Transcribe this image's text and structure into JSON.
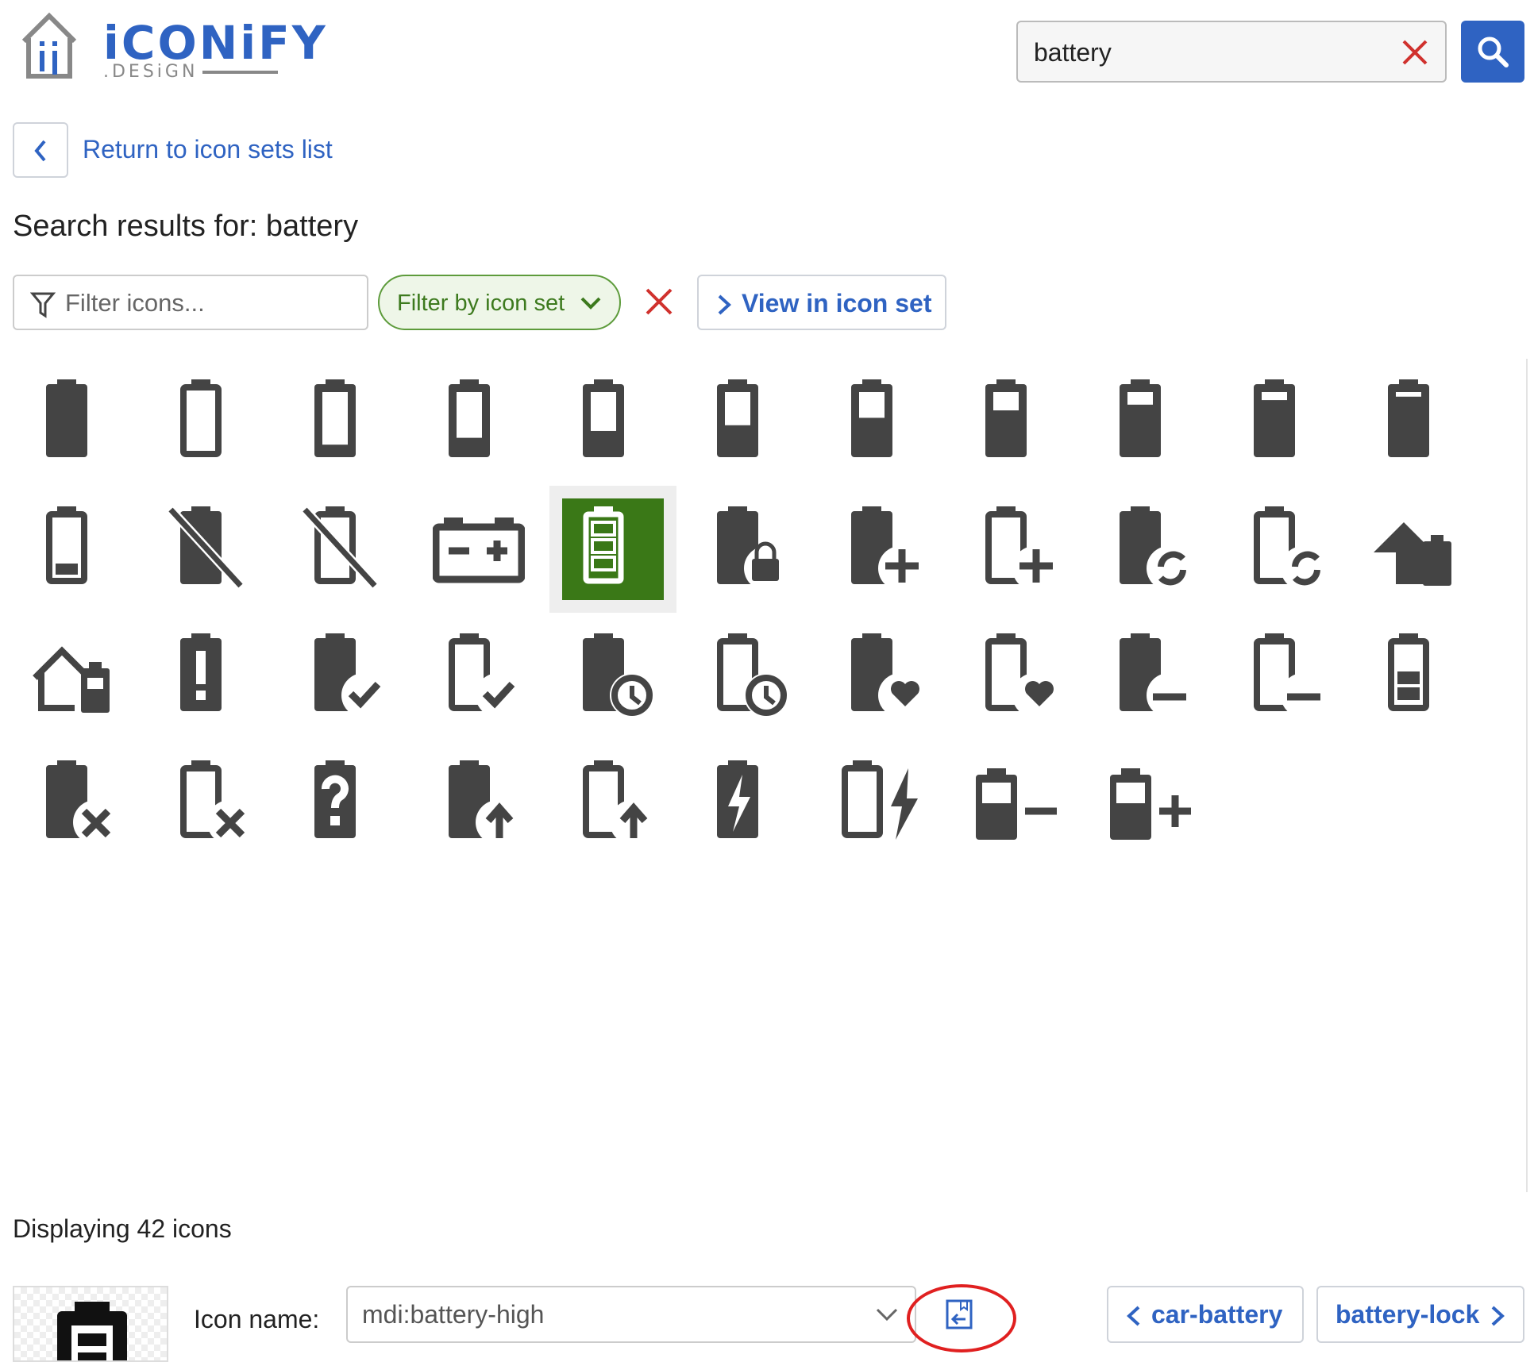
{
  "header": {
    "logo_text": "iCONiFY",
    "logo_sub": ".DESiGN",
    "search_value": "battery"
  },
  "nav": {
    "back_label": "Return to icon sets list"
  },
  "results": {
    "title": "Search results for: battery"
  },
  "filters": {
    "filter_placeholder": "Filter icons...",
    "filter_by_set_label": "Filter by icon set",
    "view_in_set_label": "View in icon set"
  },
  "icons": [
    "battery",
    "battery-outline",
    "battery-10",
    "battery-20",
    "battery-30",
    "battery-40",
    "battery-50",
    "battery-60",
    "battery-70",
    "battery-80",
    "battery-90",
    "battery-alert-variant-outline",
    "battery-off",
    "battery-off-outline",
    "car-battery",
    "battery-high",
    "battery-lock",
    "battery-plus",
    "battery-plus-outline",
    "battery-sync",
    "battery-sync-outline",
    "home-battery",
    "home-battery-outline",
    "battery-alert",
    "battery-check",
    "battery-check-outline",
    "battery-clock",
    "battery-clock-outline",
    "battery-heart",
    "battery-heart-outline",
    "battery-minus",
    "battery-minus-outline",
    "battery-medium",
    "battery-remove",
    "battery-remove-outline",
    "battery-unknown",
    "battery-arrow-up",
    "battery-arrow-up-outline",
    "battery-charging",
    "battery-charging-outline",
    "battery-negative",
    "battery-positive"
  ],
  "selected_icon": "battery-high",
  "status": {
    "count_text": "Displaying 42 icons"
  },
  "footer": {
    "icon_name_label": "Icon name:",
    "icon_name_value": "mdi:battery-high",
    "prev_label": "car-battery",
    "next_label": "battery-lock"
  },
  "colors": {
    "accent": "#2f63c2",
    "selected_bg": "#3a7817",
    "icon": "#444444",
    "danger": "#d0312d",
    "filter_green": "#3d7a1e"
  }
}
